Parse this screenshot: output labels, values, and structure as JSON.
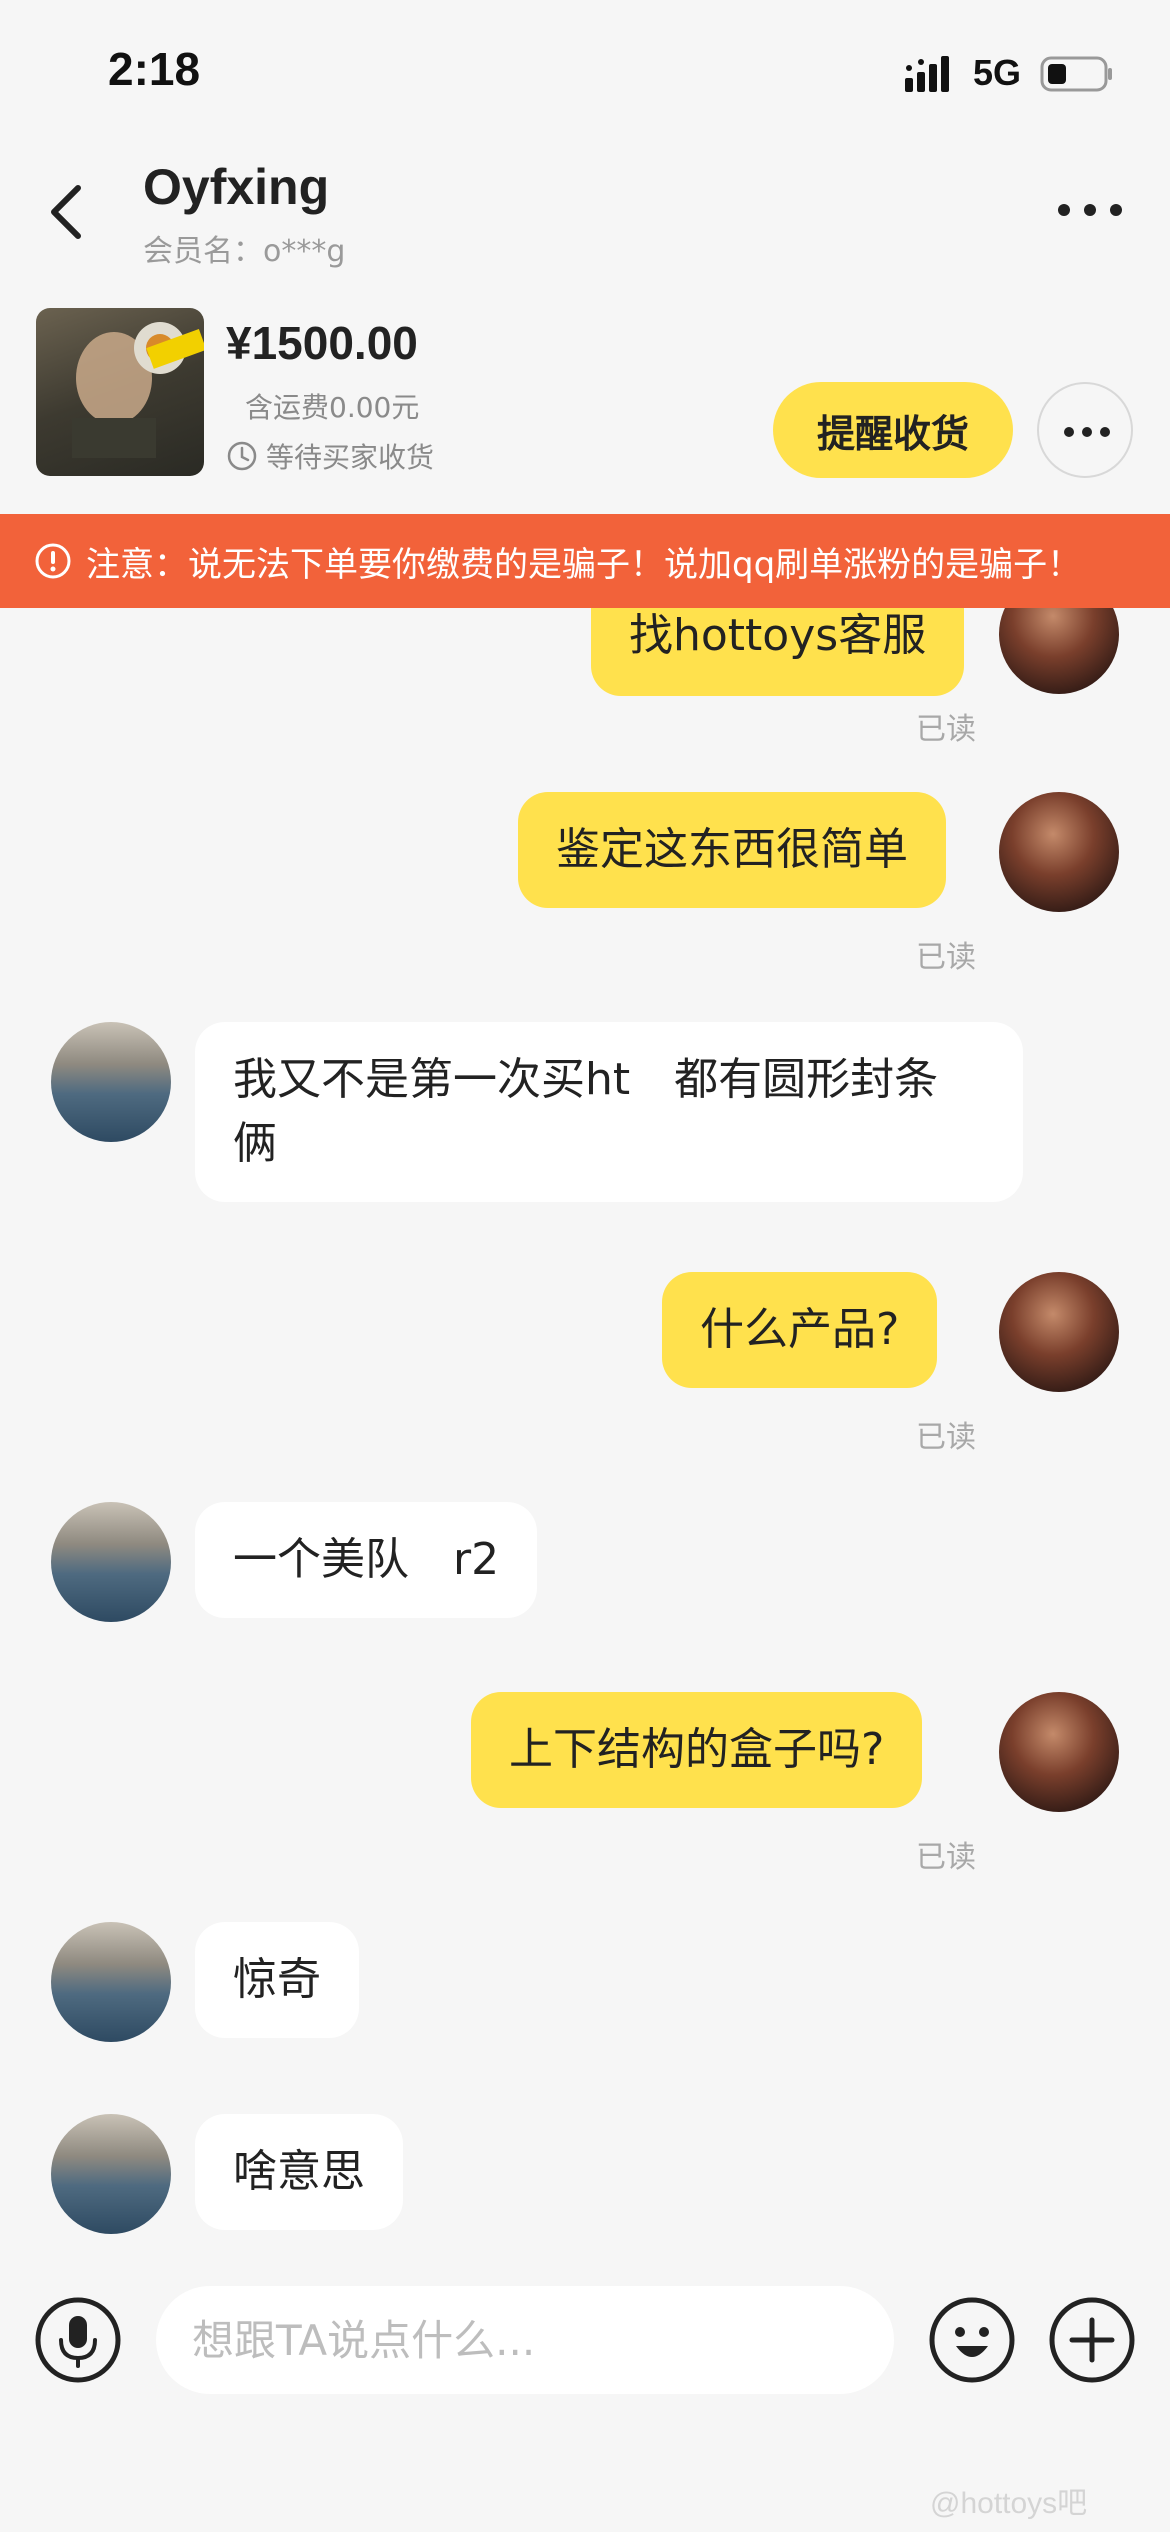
{
  "status_bar": {
    "time": "2:18",
    "network": "5G"
  },
  "header": {
    "contact_name": "Oyfxing",
    "member_name": "会员名：o***g"
  },
  "order": {
    "price": "¥1500.00",
    "shipping": "含运费0.00元",
    "status": "等待买家收货",
    "remind_label": "提醒收货"
  },
  "warning": {
    "text": "注意：说无法下单要你缴费的是骗子！说加qq刷单涨粉的是骗子！"
  },
  "messages": [
    {
      "from": "me",
      "text": "找hottoys客服",
      "read": "已读"
    },
    {
      "from": "me",
      "text": "鉴定这东西很简单",
      "read": "已读"
    },
    {
      "from": "them",
      "text": "我又不是第一次买ht　都有圆形封条　俩"
    },
    {
      "from": "me",
      "text": "什么产品?",
      "read": "已读"
    },
    {
      "from": "them",
      "text": "一个美队　r2"
    },
    {
      "from": "me",
      "text": "上下结构的盒子吗?",
      "read": "已读"
    },
    {
      "from": "them",
      "text": "惊奇"
    },
    {
      "from": "them",
      "text": "啥意思"
    }
  ],
  "input": {
    "placeholder": "想跟TA说点什么..."
  },
  "watermark": "@hottoys吧",
  "colors": {
    "accent": "#ffe14d",
    "warning": "#f2623a",
    "background": "#f6f6f6"
  }
}
